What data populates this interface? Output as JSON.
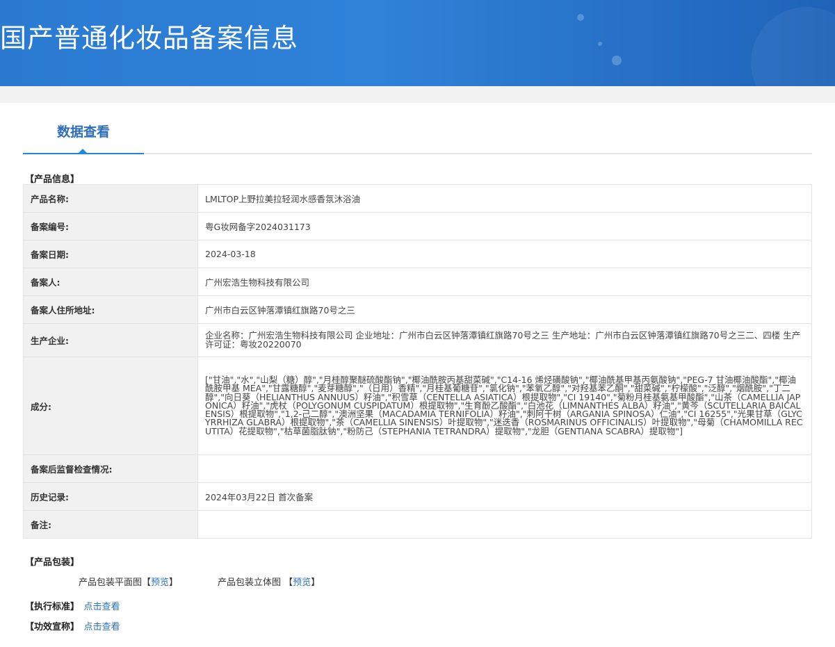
{
  "header": {
    "title": "国产普通化妆品备案信息"
  },
  "tabs": [
    {
      "label": "数据查看"
    }
  ],
  "product_info": {
    "heading": "【产品信息】",
    "rows": [
      {
        "label": "产品名称:",
        "value": "LMLTOP上野拉美拉轻润水感香氛沐浴油"
      },
      {
        "label": "备案编号:",
        "value": "粤G妆网备字2024031173"
      },
      {
        "label": "备案日期:",
        "value": "2024-03-18"
      },
      {
        "label": "备案人:",
        "value": "广州宏浩生物科技有限公司"
      },
      {
        "label": "备案人住所地址:",
        "value": "广州市白云区钟落潭镇红旗路70号之三"
      },
      {
        "label": "生产企业:",
        "value": "企业名称：广州宏浩生物科技有限公司 企业地址：广州市白云区钟落潭镇红旗路70号之三 生产地址：广州市白云区钟落潭镇红旗路70号之三二、四楼 生产许可证：粤妆20220070"
      },
      {
        "label": "成分:",
        "value": "[\"甘油\",\"水\",\"山梨（糖）醇\",\"月桂醇聚醚硫酸酯钠\",\"椰油酰胺丙基甜菜碱\",\"C14-16 烯烃磺酸钠\",\"椰油酰基甲基丙氨酸钠\",\"PEG-7 甘油椰油酸酯\",\"椰油酰胺甲基 MEA\",\"甘露糖醇\",\"麦芽糖醇\",\"（日用）香精\",\"月桂基葡糖苷\",\"氯化钠\",\"苯氧乙醇\",\"对羟基苯乙酮\",\"甜菜碱\",\"柠檬酸\",\"泛醇\",\"烟酰胺\",\"丁二醇\",\"向日葵（HELIANTHUS ANNUUS）籽油\",\"积雪草（CENTELLA ASIATICA）根提取物\",\"CI 19140\",\"菊粉月桂基氨基甲酸酯\",\"山茶（CAMELLIA JAPONICA）籽油\",\"虎杖（POLYGONUM CUSPIDATUM）根提取物\",\"生育酚乙酸酯\",\"白池花（LIMNANTHES ALBA）籽油\",\"黄芩（SCUTELLARIA BAICALENSIS）根提取物\",\"1,2-己二醇\",\"澳洲坚果（MACADAMIA TERNIFOLIA）籽油\",\"刺阿干树（ARGANIA SPINOSA）仁油\",\"CI 16255\",\"光果甘草（GLYCYRRHIZA GLABRA）根提取物\",\"茶（CAMELLIA SINENSIS）叶提取物\",\"迷迭香（ROSMARINUS OFFICINALIS）叶提取物\",\"母菊（CHAMOMILLA RECUTITA）花提取物\",\"枯草菌脂肽钠\",\"粉防己（STEPHANIA TETRANDRA）提取物\",\"龙胆（GENTIANA SCABRA）提取物\"]"
      },
      {
        "label": "备案后监督检查情况:",
        "value": ""
      },
      {
        "label": "历史记录:",
        "value": "2024年03月22日 首次备案"
      },
      {
        "label": "备注:",
        "value": ""
      }
    ]
  },
  "packaging": {
    "heading": "【产品包装】",
    "flat_label": "产品包装平面图",
    "solid_label": "产品包装立体图",
    "bracket_open": "【",
    "bracket_close": "】",
    "preview_label": "预览"
  },
  "standard": {
    "label": "【执行标准】",
    "link": "点击查看"
  },
  "efficacy": {
    "label": "【功效宣称】",
    "link": "点击查看"
  },
  "colors": {
    "banner": "#2a7ad2",
    "tab_active": "#2f6db5",
    "link": "#2a72c0",
    "table_border": "#a7c3e2"
  }
}
